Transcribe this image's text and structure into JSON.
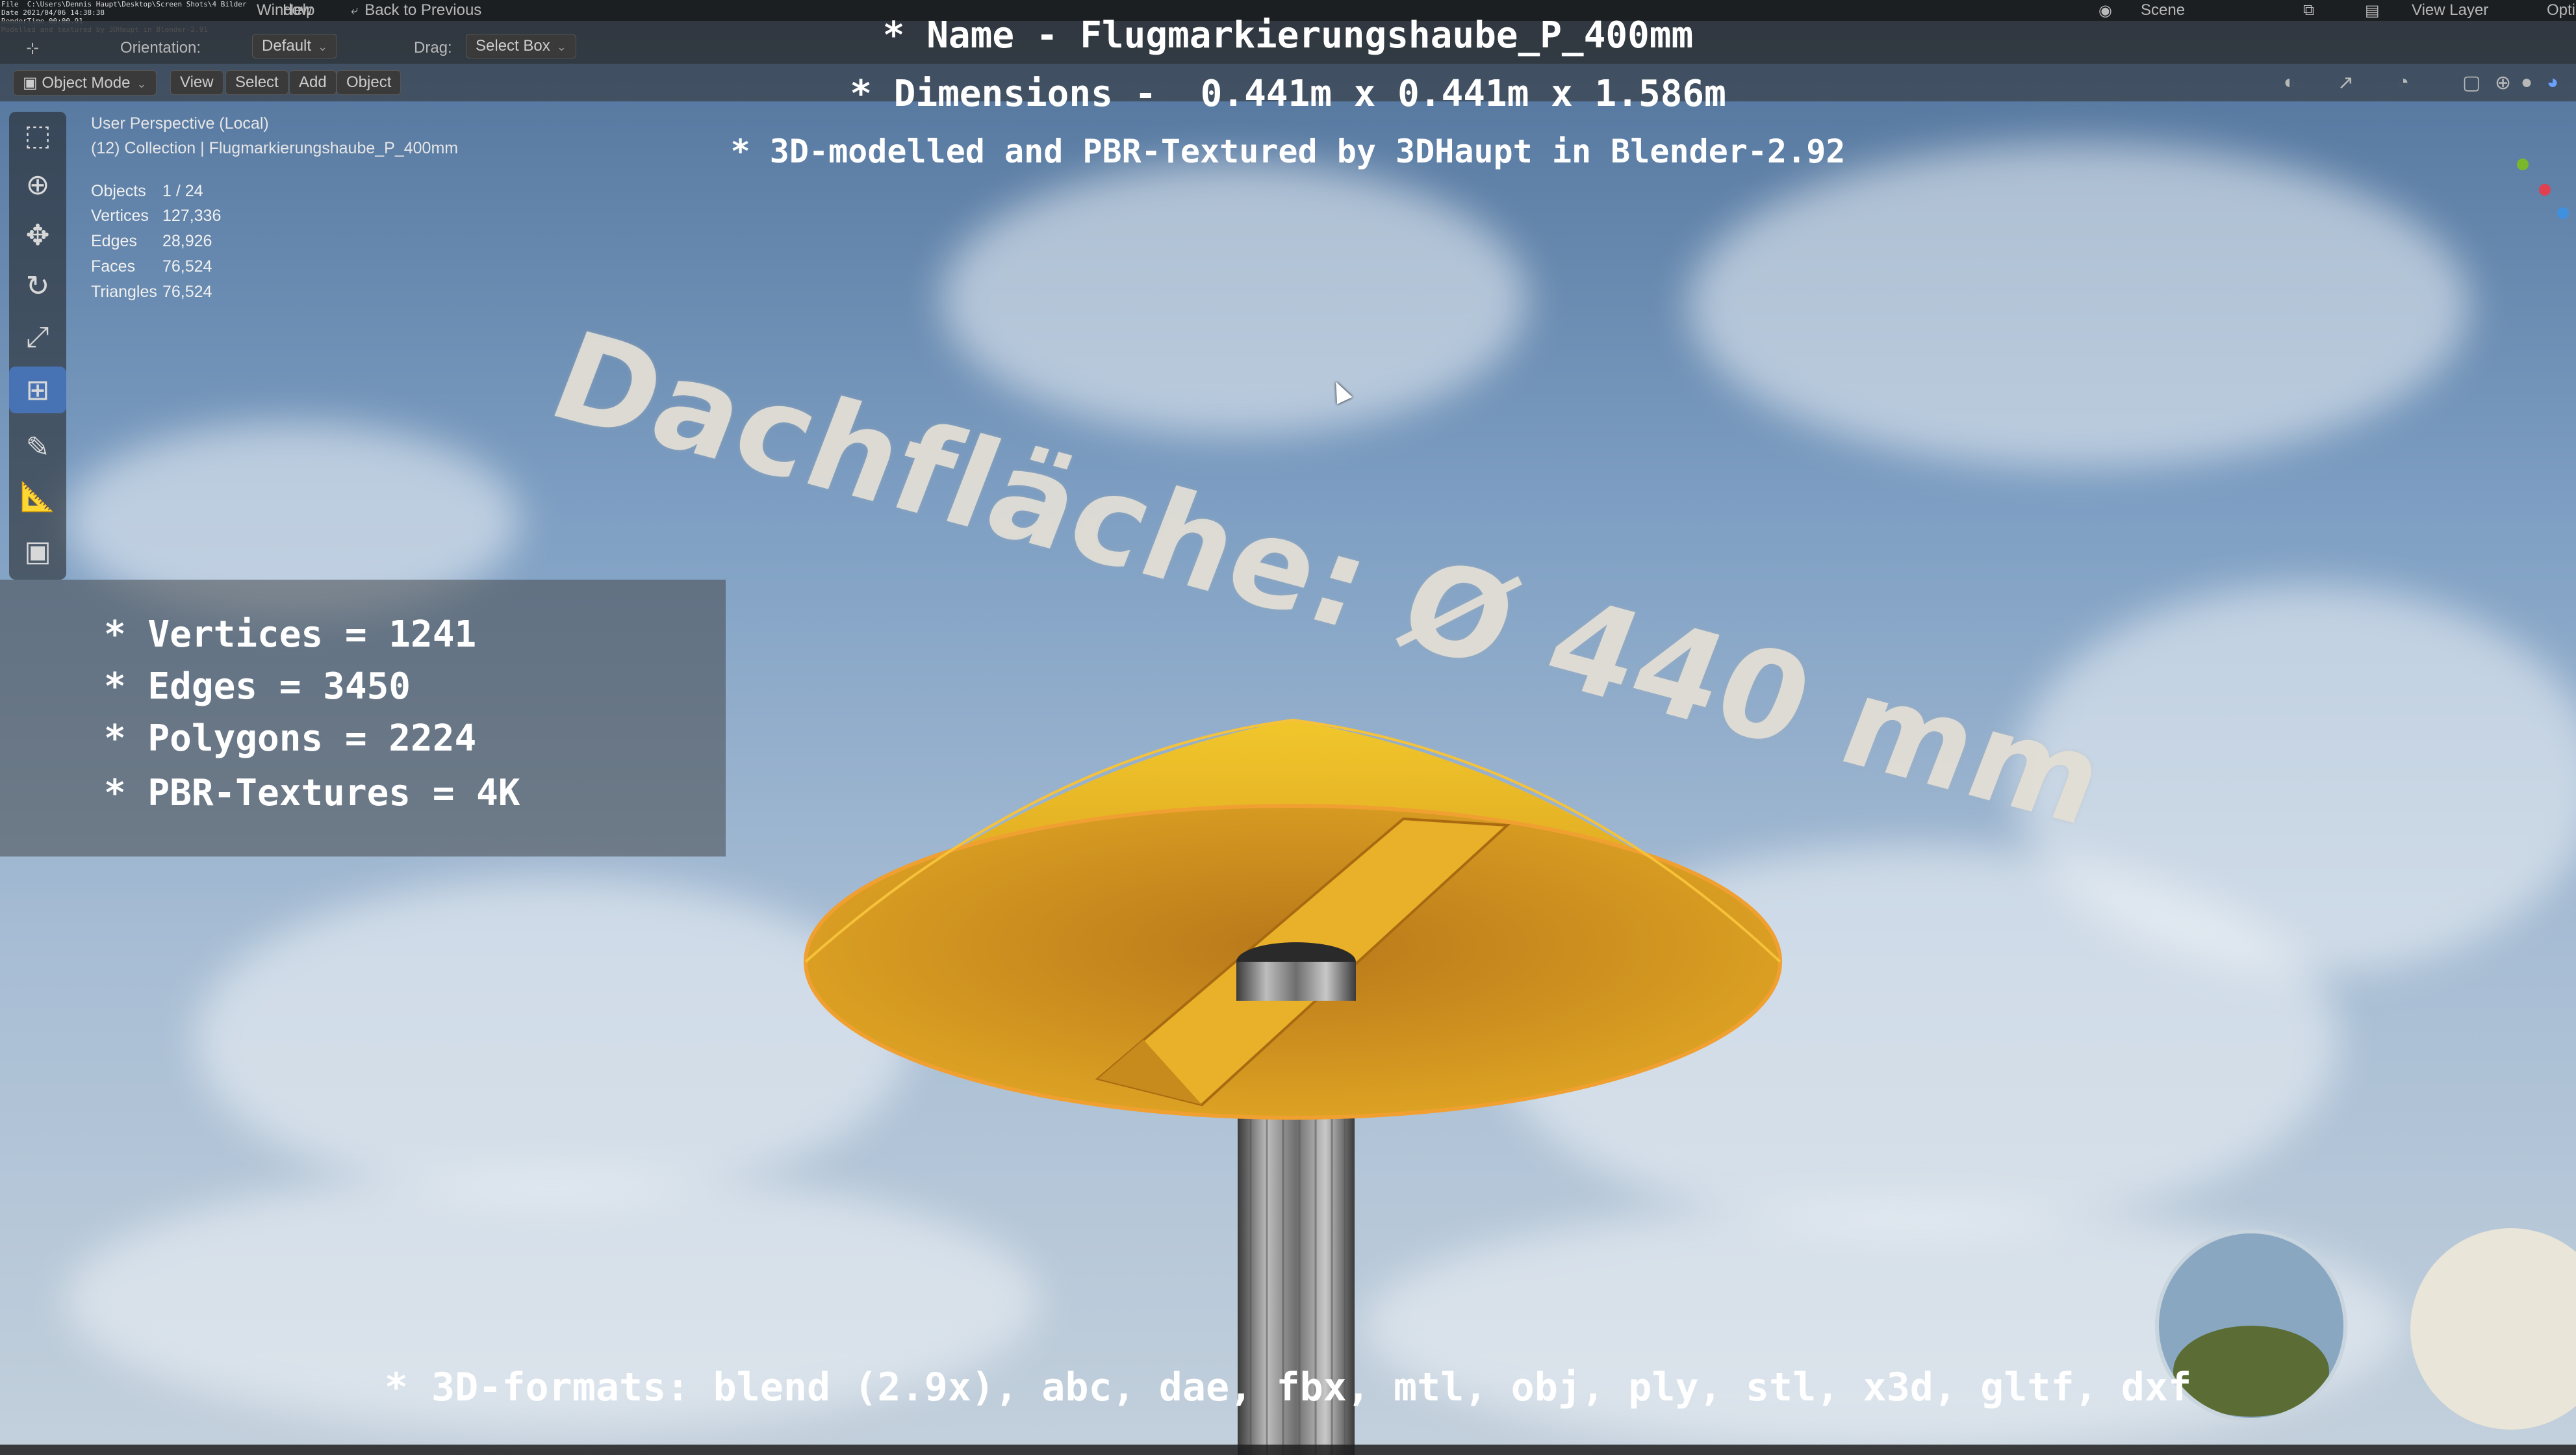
{
  "topbar": {
    "menu_items": [
      "Window",
      "Help"
    ],
    "back_to_previous": "Back to Previous",
    "scene": "Scene",
    "view_layer": "View Layer",
    "options": "Opti",
    "render_stamp": "File  C:\\Users\\Dennis Haupt\\Desktop\\Screen Shots\\4 Bilder\nDate 2021/04/06 14:38:38\nRenderTime 00:00.91\nModelled and textured by 3DHaupt in Blender-2.91"
  },
  "toolbar": {
    "orientation_label": "Orientation:",
    "orientation_value": "Default",
    "drag_label": "Drag:",
    "drag_value": "Select Box"
  },
  "header": {
    "mode": "Object Mode",
    "menus": [
      "View",
      "Select",
      "Add",
      "Object"
    ]
  },
  "viewport_info": {
    "perspective": "User Perspective (Local)",
    "collection": "(12) Collection | Flugmarkierungshaube_P_400mm",
    "stats": [
      {
        "label": "Objects",
        "value": "1 / 24"
      },
      {
        "label": "Vertices",
        "value": "127,336"
      },
      {
        "label": "Edges",
        "value": "28,926"
      },
      {
        "label": "Faces",
        "value": "76,524"
      },
      {
        "label": "Triangles",
        "value": "76,524"
      }
    ]
  },
  "overlay": {
    "name_line": "* Name - Flugmarkierungshaube_P_400mm",
    "dimensions_line": "* Dimensions -  0.441m x 0.441m x 1.586m",
    "credit_line": "* 3D-modelled and PBR-Textured by 3DHaupt in Blender-2.92",
    "specs": [
      "* Vertices = 1241",
      "* Edges = 3450",
      "* Polygons = 2224",
      "* PBR-Textures = 4K"
    ],
    "formats_line": "* 3D-formats: blend (2.9x), abc, dae, fbx, mtl, obj, ply, stl, x3d, gltf, dxf"
  },
  "scene_text": "Dachfläche: Ø 440 mm",
  "icons": {
    "tools": [
      "select-box-icon",
      "cursor-icon",
      "move-icon",
      "rotate-icon",
      "scale-icon",
      "transform-icon",
      "annotate-icon",
      "measure-icon",
      "add-cube-icon"
    ]
  },
  "colors": {
    "hood_yellow": "#e3b224",
    "active_tool": "#4772b3",
    "pole_gray": "#8a8a8a"
  }
}
